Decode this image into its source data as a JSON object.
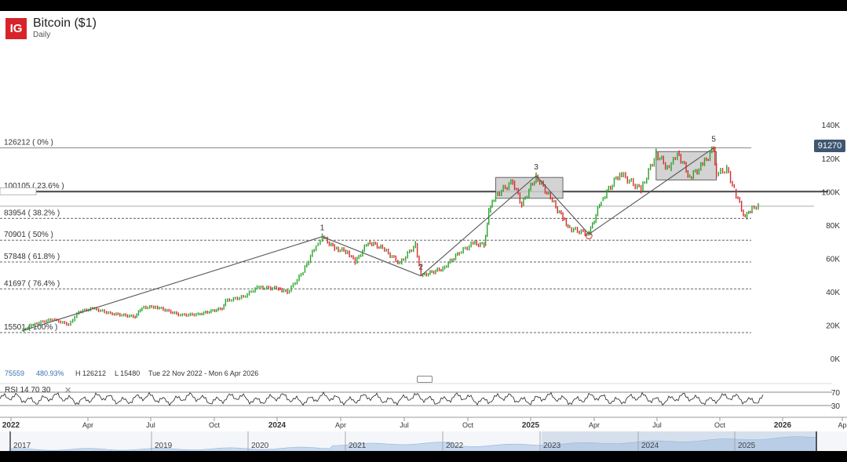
{
  "header": {
    "logo_text": "IG",
    "title": "Bitcoin ($1)",
    "subtitle": "Daily",
    "current_price": "91270"
  },
  "stats": {
    "first": "75559",
    "second": "480.93%",
    "high": "H 126212",
    "low": "L 15480",
    "range": "Tue 22 Nov 2022 - Mon 6 Apr 2026"
  },
  "rsi": {
    "label": "RSI  14  70  30",
    "close_icon": "close-icon",
    "levels": [
      70,
      30
    ]
  },
  "navigator": {
    "years": [
      "2017",
      "2019",
      "2020",
      "2021",
      "2022",
      "2023",
      "2024",
      "2025"
    ]
  },
  "colors": {
    "up": "#27a327",
    "down": "#d72c2c",
    "logo": "#d6242a",
    "price_tag": "#3f5670"
  },
  "chart_data": {
    "type": "line",
    "title": "Bitcoin ($1)",
    "xlabel": "",
    "ylabel": "",
    "ylim": [
      0,
      140000
    ],
    "y_ticks": [
      "140K",
      "120K",
      "100K",
      "80K",
      "60K",
      "40K",
      "20K",
      "0K"
    ],
    "x_ticks": [
      "2022",
      "Apr",
      "Jul",
      "Oct",
      "2024",
      "Apr",
      "Jul",
      "Oct",
      "2025",
      "Apr",
      "Jul",
      "Oct",
      "2026",
      "Ap"
    ],
    "grid": false,
    "fib_levels": [
      {
        "label": "126212 ( 0% )",
        "value": 126212
      },
      {
        "label": "100105 ( 23.6% )",
        "value": 100105
      },
      {
        "label": "83954 ( 38.2% )",
        "value": 83954
      },
      {
        "label": "70901 ( 50% )",
        "value": 70901
      },
      {
        "label": "57848 ( 61.8% )",
        "value": 57848
      },
      {
        "label": "41697 ( 76.4% )",
        "value": 41697
      },
      {
        "label": "15501 ( 100% )",
        "value": 15501
      }
    ],
    "reference_levels": [
      100000,
      91270
    ],
    "wave_points": [
      {
        "label": "",
        "x": "2023-01-01",
        "y": 16500
      },
      {
        "label": "1",
        "x": "2024-03-14",
        "y": 73000
      },
      {
        "label": "2",
        "x": "2024-08-05",
        "y": 49500
      },
      {
        "label": "3",
        "x": "2025-01-20",
        "y": 109500
      },
      {
        "label": "",
        "x": "2025-04-07",
        "y": 74500
      },
      {
        "label": "5",
        "x": "2025-10-06",
        "y": 126212
      }
    ],
    "series": [
      {
        "x": [
          "2023-01-01",
          "2023-01-20",
          "2023-02-15",
          "2023-03-10",
          "2023-03-25",
          "2023-04-14",
          "2023-05-10",
          "2023-06-15",
          "2023-06-25",
          "2023-07-15",
          "2023-08-20",
          "2023-09-15",
          "2023-10-20",
          "2023-10-25",
          "2023-11-20",
          "2023-12-10",
          "2024-01-10",
          "2024-01-23",
          "2024-02-15",
          "2024-03-05",
          "2024-03-14",
          "2024-04-01",
          "2024-04-20",
          "2024-05-01",
          "2024-05-20",
          "2024-06-10",
          "2024-07-05",
          "2024-07-28",
          "2024-08-05",
          "2024-09-06",
          "2024-09-30",
          "2024-10-20",
          "2024-11-05",
          "2024-11-12",
          "2024-11-22",
          "2024-12-17",
          "2024-12-30",
          "2025-01-20",
          "2025-02-10",
          "2025-02-28",
          "2025-03-10",
          "2025-04-07",
          "2025-04-25",
          "2025-05-22",
          "2025-06-22",
          "2025-07-14",
          "2025-08-02",
          "2025-08-14",
          "2025-09-01",
          "2025-09-20",
          "2025-10-06",
          "2025-10-10",
          "2025-10-25",
          "2025-11-05",
          "2025-11-21",
          "2025-12-01",
          "2025-12-10"
        ],
        "values": [
          16500,
          21000,
          23500,
          20300,
          28000,
          30000,
          27000,
          25000,
          30500,
          31000,
          26000,
          26500,
          30000,
          34500,
          37000,
          42500,
          42000,
          39500,
          52000,
          68000,
          73000,
          66000,
          64000,
          57500,
          70000,
          66000,
          57000,
          68500,
          49500,
          54000,
          63500,
          69000,
          68000,
          88000,
          98000,
          106000,
          92000,
          109500,
          96000,
          84000,
          78000,
          74500,
          95000,
          111000,
          101000,
          123000,
          113000,
          124000,
          108500,
          116000,
          126212,
          110000,
          114000,
          101000,
          84000,
          91000,
          91270
        ]
      }
    ],
    "rsi_ylim": [
      0,
      100
    ]
  }
}
